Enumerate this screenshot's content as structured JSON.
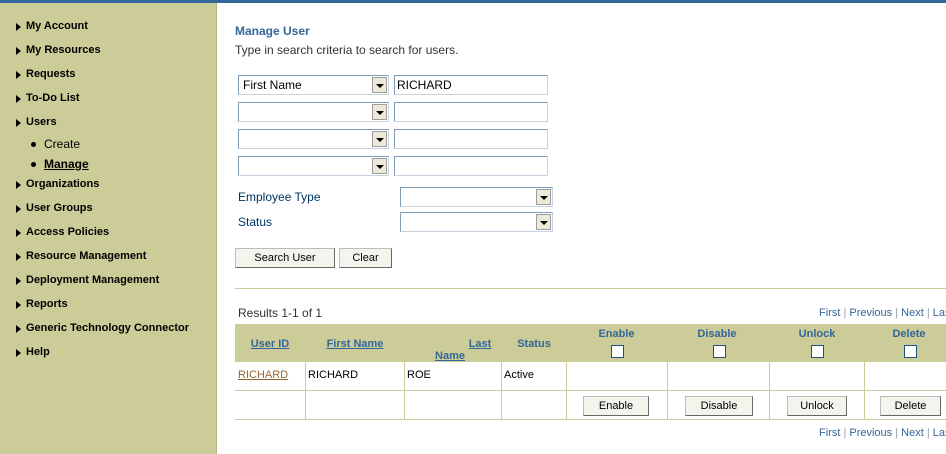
{
  "sidebar": {
    "items": [
      {
        "label": "My Account"
      },
      {
        "label": "My Resources"
      },
      {
        "label": "Requests"
      },
      {
        "label": "To-Do List"
      },
      {
        "label": "Users"
      },
      {
        "label": "Organizations"
      },
      {
        "label": "User Groups"
      },
      {
        "label": "Access Policies"
      },
      {
        "label": "Resource Management"
      },
      {
        "label": "Deployment Management"
      },
      {
        "label": "Reports"
      },
      {
        "label": "Generic Technology Connector"
      },
      {
        "label": "Help"
      }
    ],
    "users_sub": [
      {
        "label": "Create"
      },
      {
        "label": "Manage",
        "active": true
      }
    ]
  },
  "main": {
    "title": "Manage User",
    "description": "Type in search criteria to search for users.",
    "criteria": [
      {
        "field": "First Name",
        "value": "RICHARD"
      },
      {
        "field": "",
        "value": ""
      },
      {
        "field": "",
        "value": ""
      },
      {
        "field": "",
        "value": ""
      }
    ],
    "employee_type_label": "Employee Type",
    "employee_type_value": "",
    "status_label": "Status",
    "status_value": "",
    "search_button": "Search User",
    "clear_button": "Clear"
  },
  "results": {
    "label": "Results 1-1 of 1",
    "pager": {
      "first": "First",
      "previous": "Previous",
      "next": "Next",
      "last": "Last",
      "sep": "|"
    },
    "columns": {
      "user_id": "User ID",
      "first_name": "First Name",
      "last_name": "Last Name",
      "status": "Status",
      "enable": "Enable",
      "disable": "Disable",
      "unlock": "Unlock",
      "delete": "Delete"
    },
    "rows": [
      {
        "user_id": "RICHARD",
        "first_name": "RICHARD",
        "last_name": "ROE",
        "status": "Active"
      }
    ],
    "actions": {
      "enable": "Enable",
      "disable": "Disable",
      "unlock": "Unlock",
      "delete": "Delete"
    }
  },
  "colors": {
    "sidebar_bg": "#cccc99",
    "accent": "#336699",
    "link_brown": "#996633"
  }
}
